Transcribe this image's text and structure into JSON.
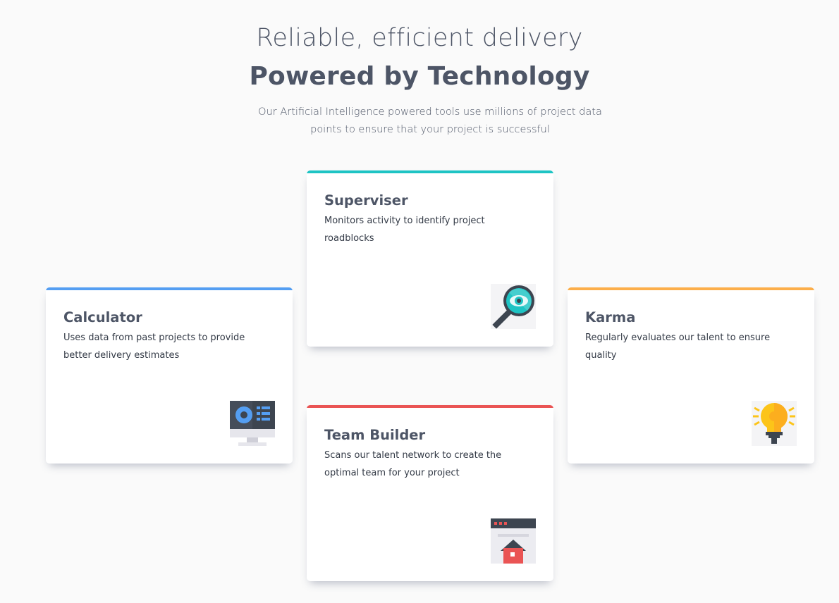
{
  "header": {
    "subtitle": "Reliable, efficient delivery",
    "title": "Powered by Technology",
    "intro": "Our Artificial Intelligence powered tools use millions of project data points to ensure that your project is successful"
  },
  "cards": {
    "superviser": {
      "title": "Superviser",
      "description": "Monitors activity to identify project roadblocks",
      "accent": "#1ec4c4",
      "icon": "magnifier-eye-icon"
    },
    "calculator": {
      "title": "Calculator",
      "description": "Uses data from past projects to provide better delivery estimates",
      "accent": "#549ef2",
      "icon": "monitor-dashboard-icon"
    },
    "team_builder": {
      "title": "Team Builder",
      "description": "Scans our talent network to create the optimal team for your project",
      "accent": "#ea5454",
      "icon": "browser-house-icon"
    },
    "karma": {
      "title": "Karma",
      "description": "Regularly evaluates our talent to ensure quality",
      "accent": "#fcae4a",
      "icon": "lightbulb-icon"
    }
  }
}
